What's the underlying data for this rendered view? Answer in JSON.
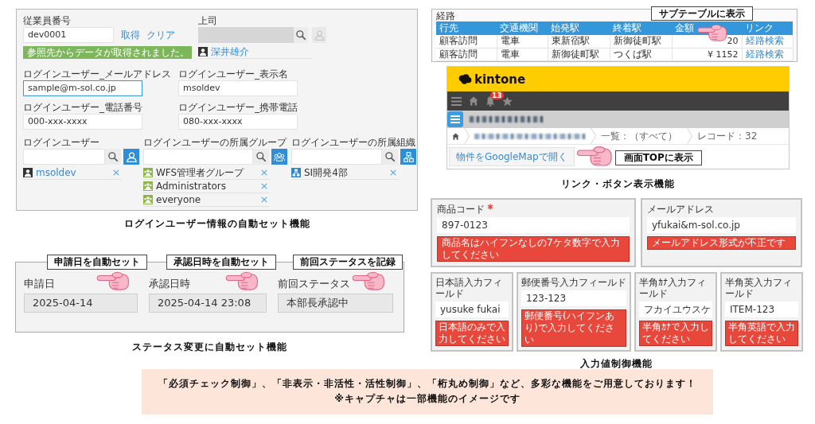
{
  "login_user_panel": {
    "employee_number": {
      "label": "従業員番号",
      "value": "dev0001",
      "actions": [
        "取得",
        "クリア"
      ],
      "notice": "参照先からデータが取得されました。"
    },
    "supervisor": {
      "label": "上司",
      "disabled": true,
      "users": [
        "深井雄介"
      ]
    },
    "fields": [
      {
        "label": "ログインユーザー_メールアドレス",
        "value": "sample@m-sol.co.jp",
        "focused": true
      },
      {
        "label": "ログインユーザー_表示名",
        "value": "msoldev",
        "focused": false
      },
      {
        "label": "ログインユーザー_電話番号",
        "value": "000-xxx-xxxx",
        "focused": false
      },
      {
        "label": "ログインユーザー_携帯電話",
        "value": "080-xxx-xxxx",
        "focused": false
      }
    ],
    "pickers": [
      {
        "kind": "user",
        "label": "ログインユーザー",
        "entries": [
          "msoldev"
        ]
      },
      {
        "kind": "group",
        "label": "ログインユーザーの所属グループ",
        "entries": [
          "WFS管理者グループ",
          "Administrators",
          "everyone"
        ]
      },
      {
        "kind": "organization",
        "label": "ログインユーザーの所属組織",
        "entries": [
          "SI開発4部"
        ]
      }
    ],
    "caption": "ログインユーザー情報の自動セット機能"
  },
  "link_button_display": {
    "route_subtable": {
      "title": "経路",
      "columns": [
        {
          "label": "行先",
          "kind": "text"
        },
        {
          "label": "交通機関",
          "kind": "text"
        },
        {
          "label": "始発駅",
          "kind": "text"
        },
        {
          "label": "終着駅",
          "kind": "text"
        },
        {
          "label": "金額",
          "kind": "amount"
        },
        {
          "label": "リンク",
          "kind": "link"
        }
      ],
      "rows": [
        [
          "顧客訪問",
          "電車",
          "東新宿駅",
          "新御徒町駅",
          "20",
          "経路検索"
        ],
        [
          "顧客訪問",
          "電車",
          "新御徒町駅",
          "つくば駅",
          "¥ 1152",
          "経路検索"
        ]
      ],
      "callout": "サブテーブルに表示"
    },
    "kintone_screen": {
      "logo": "kintone",
      "notification_count": "13",
      "breadcrumbs": [
        "一覧：（すべて）",
        "レコード：32"
      ],
      "button": "物件をGoogleMapで開く",
      "callout": "画面TOPに表示"
    },
    "caption": "リンク・ボタン表示機能"
  },
  "status_autoset": {
    "fields": [
      {
        "callout": "申請日を自動セット",
        "label": "申請日",
        "value": "2025-04-14"
      },
      {
        "callout": "承認日時を自動セット",
        "label": "承認日時",
        "value": "2025-04-14 23:08"
      },
      {
        "callout": "前回ステータスを記録",
        "label": "前回ステータス",
        "value": "本部長承認中"
      }
    ],
    "caption": "ステータス変更に自動セット機能"
  },
  "input_validation": {
    "fields": [
      {
        "kind": "wide",
        "label": "商品コード",
        "required": true,
        "value": "897-0123",
        "error": "商品名はハイフンなしの7ケタ数字で入力してください"
      },
      {
        "kind": "wide",
        "label": "メールアドレス",
        "required": false,
        "value": "yfukai&m-sol.co.jp",
        "error": "メールアドレス形式が不正です"
      },
      {
        "kind": "narrow",
        "label": "日本語入力フィールド",
        "required": false,
        "value": "yusuke fukai",
        "error": "日本語のみで入力してください"
      },
      {
        "kind": "narrow",
        "label": "郵便番号入力フィールド",
        "required": false,
        "value": "123-123",
        "error": "郵便番号(ハイフンあり)で入力してください"
      },
      {
        "kind": "narrow",
        "label": "半角ｶﾅ入力フィールド",
        "required": false,
        "value": "フカイユウスケ",
        "error": "半角ｶﾅで入力してください"
      },
      {
        "kind": "narrow",
        "label": "半角英入力フィールド",
        "required": false,
        "value": "ITEM-123",
        "error": "半角英語で入力してください"
      }
    ],
    "caption": "入力値制御機能"
  },
  "banner": {
    "lines": [
      "「必須チェック制御」、「非表示・非活性・活性制御」、「桁丸め制御」など、多彩な機能をご用意しております！",
      "※キャプチャは一部機能のイメージです"
    ]
  }
}
